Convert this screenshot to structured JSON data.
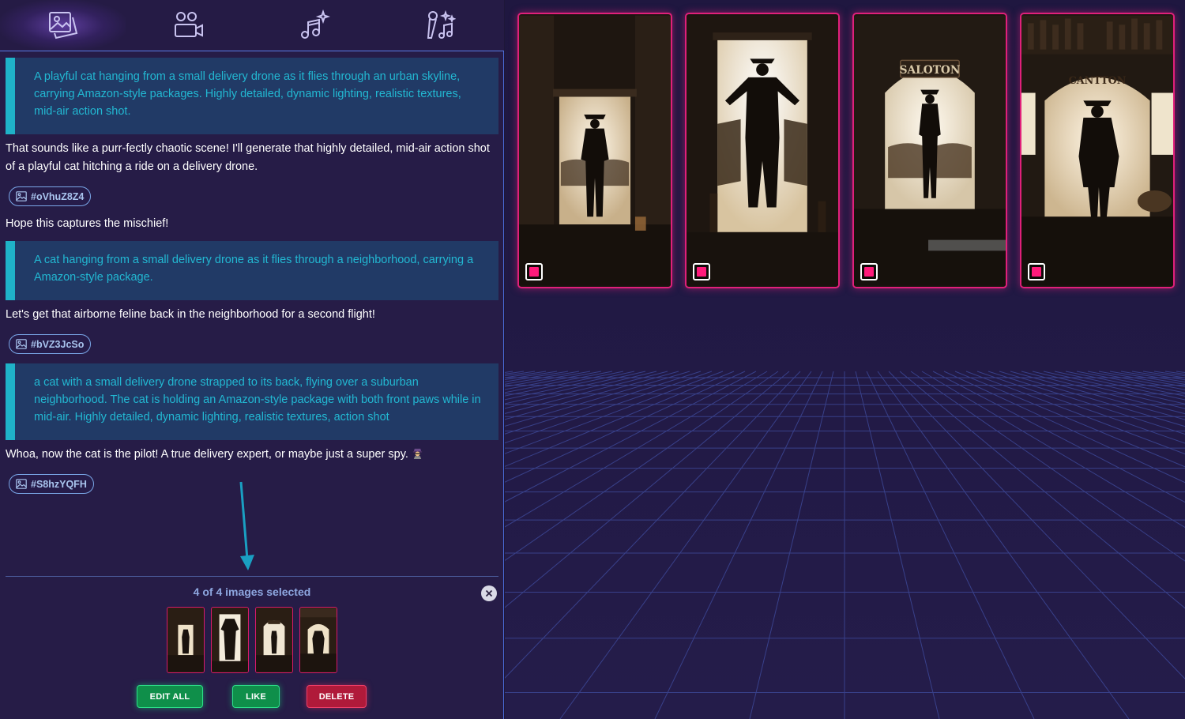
{
  "tabs": [
    {
      "name": "images",
      "icon": "image-gallery-icon",
      "active": true
    },
    {
      "name": "video",
      "icon": "video-people-icon",
      "active": false
    },
    {
      "name": "music",
      "icon": "music-sparkle-icon",
      "active": false
    },
    {
      "name": "voice",
      "icon": "microphone-music-icon",
      "active": false
    }
  ],
  "chat": {
    "prompt_1": "A playful cat hanging from a small delivery drone as it flies through an urban skyline, carrying Amazon-style packages. Highly detailed, dynamic lighting, realistic textures, mid-air action shot.",
    "reply_1": "That sounds like a purr-fectly chaotic scene! I'll generate that highly detailed, mid-air action shot of a playful cat hitching a ride on a delivery drone.",
    "chip_1": "#oVhuZ8Z4",
    "reply_1b": "Hope this captures the mischief!",
    "prompt_2": "A cat hanging from a small delivery drone as it flies through a neighborhood, carrying a Amazon-style package.",
    "reply_2": "Let's get that airborne feline back in the neighborhood for a second flight!",
    "chip_2": "#bVZ3JcSo",
    "prompt_3": "a cat with a small delivery drone strapped to its back, flying over a suburban neighborhood. The cat is holding an Amazon-style package with both front paws while in mid-air. Highly detailed, dynamic lighting, realistic textures, action shot",
    "reply_3": "Whoa, now the cat is the pilot! A true delivery expert, or maybe just a super spy.",
    "chip_3": "#S8hzYQFH"
  },
  "selection": {
    "count_text": "4 of 4 images selected",
    "edit_all_label": "EDIT ALL",
    "like_label": "LIKE",
    "delete_label": "DELETE"
  },
  "gallery": {
    "images": [
      {
        "alt": "cowboy silhouette in saloon doorway",
        "sign": "",
        "selected": true
      },
      {
        "alt": "cowboy pushing open saloon doors",
        "sign": "",
        "selected": true
      },
      {
        "alt": "cowboy walking under saloon sign",
        "sign": "SALOTON",
        "selected": true
      },
      {
        "alt": "cowboy in saloon with bottles",
        "sign": "CANTTON",
        "selected": true
      }
    ]
  },
  "colors": {
    "accent_pink": "#e0207a",
    "accent_cyan": "#1fb2c8",
    "panel_bg": "#261c47",
    "green": "#0f8f4a",
    "red": "#b01a3a"
  }
}
